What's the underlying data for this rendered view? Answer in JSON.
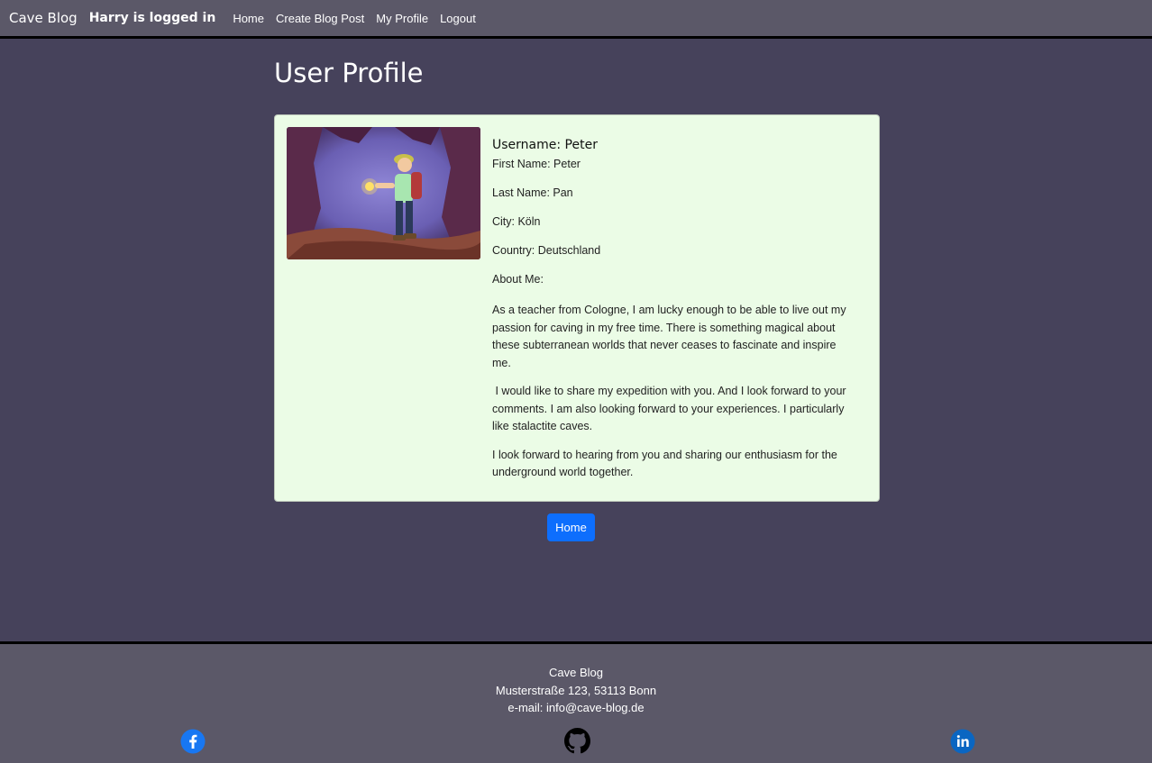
{
  "navbar": {
    "brand": "Cave Blog",
    "logged_in": "Harry is logged in",
    "links": [
      "Home",
      "Create Blog Post",
      "My Profile",
      "Logout"
    ]
  },
  "page": {
    "title": "User Profile"
  },
  "profile": {
    "username": "Username: Peter",
    "first_name": "First Name: Peter",
    "last_name": "Last Name: Pan",
    "city": "City: Köln",
    "country": "Country: Deutschland",
    "about_label": "About Me:",
    "about": [
      "As a teacher from Cologne, I am lucky enough to be able to live out my passion for caving in my free time. There is something magical about these subterranean worlds that never ceases to fascinate and inspire me.",
      " I would like to share my expedition with you. And I look forward to your comments. I am also looking forward to your experiences. I particularly like stalactite caves.",
      "I look forward to hearing from you and sharing our enthusiasm for the underground world together."
    ]
  },
  "actions": {
    "home_label": "Home"
  },
  "footer": {
    "name": "Cave Blog",
    "address": "Musterstraße 123, 53113 Bonn",
    "email": "e-mail: info@cave-blog.de"
  },
  "social": {
    "facebook_icon": "facebook-icon",
    "github_icon": "github-icon",
    "linkedin_icon": "linkedin-icon"
  },
  "colors": {
    "primary_button": "#0d6efd",
    "background": "#46425b",
    "navbar": "#5b5868",
    "card": "#ebfce6"
  }
}
